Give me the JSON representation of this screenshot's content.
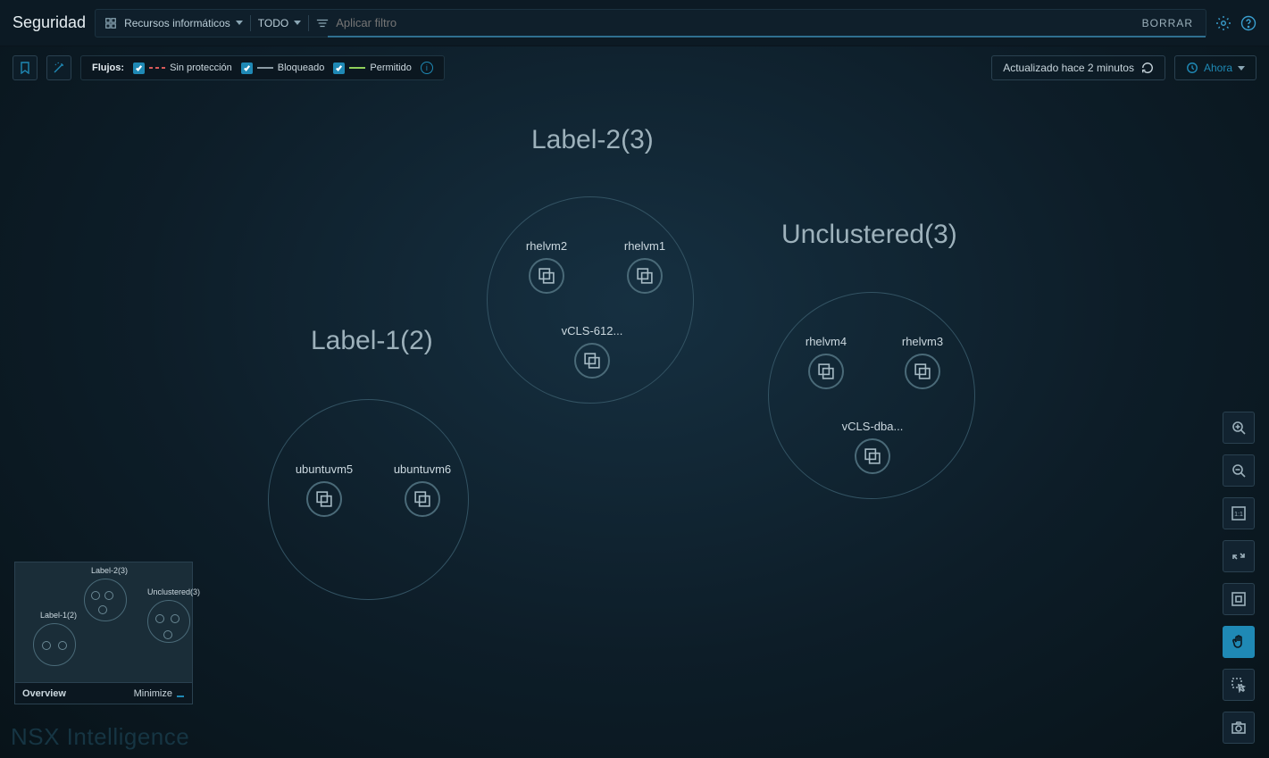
{
  "header": {
    "title": "Seguridad",
    "resourceDropdown": "Recursos informáticos",
    "scopeDropdown": "TODO",
    "filterPlaceholder": "Aplicar filtro",
    "clear": "BORRAR"
  },
  "flows": {
    "label": "Flujos:",
    "unprotected": "Sin protección",
    "blocked": "Bloqueado",
    "allowed": "Permitido"
  },
  "status": {
    "updated": "Actualizado hace 2 minutos",
    "now": "Ahora"
  },
  "groups": {
    "g1": {
      "label": "Label-1(2)"
    },
    "g2": {
      "label": "Label-2(3)"
    },
    "g3": {
      "label": "Unclustered(3)"
    }
  },
  "vms": {
    "rhelvm2": "rhelvm2",
    "rhelvm1": "rhelvm1",
    "vcls612": "vCLS-612...",
    "ubuntuvm5": "ubuntuvm5",
    "ubuntuvm6": "ubuntuvm6",
    "rhelvm4": "rhelvm4",
    "rhelvm3": "rhelvm3",
    "vclsdba": "vCLS-dba..."
  },
  "overview": {
    "title": "Overview",
    "minimize": "Minimize",
    "labels": {
      "a": "Label-2(3)",
      "b": "Unclustered(3)",
      "c": "Label-1(2)"
    }
  },
  "brand": "NSX Intelligence"
}
